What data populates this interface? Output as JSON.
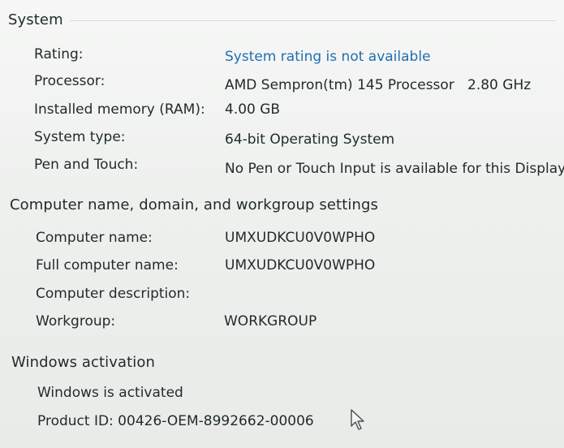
{
  "system": {
    "title": "System",
    "rating_label": "Rating:",
    "rating_value": "System rating is not available",
    "processor_label": "Processor:",
    "processor_value": "AMD Sempron(tm) 145 Processor   2.80 GHz",
    "memory_label": "Installed memory (RAM):",
    "memory_value": "4.00 GB",
    "type_label": "System type:",
    "type_value": "64-bit Operating System",
    "pen_label": "Pen and Touch:",
    "pen_value": "No Pen or Touch Input is available for this Display"
  },
  "computer": {
    "title": "Computer name, domain, and workgroup settings",
    "name_label": "Computer name:",
    "name_value": "UMXUDKCU0V0WPHO",
    "full_label": "Full computer name:",
    "full_value": "UMXUDKCU0V0WPHO",
    "description_label": "Computer description:",
    "workgroup_label": "Workgroup:",
    "workgroup_value": "WORKGROUP"
  },
  "activation": {
    "title": "Windows activation",
    "status": "Windows is activated",
    "product_id": "Product ID: 00426-OEM-8992662-00006"
  },
  "colors": {
    "link": "#1f6fb2",
    "text": "#1f2a2a",
    "background": "#f1f2f1"
  },
  "icons": {
    "cursor": "mouse-pointer-icon"
  }
}
